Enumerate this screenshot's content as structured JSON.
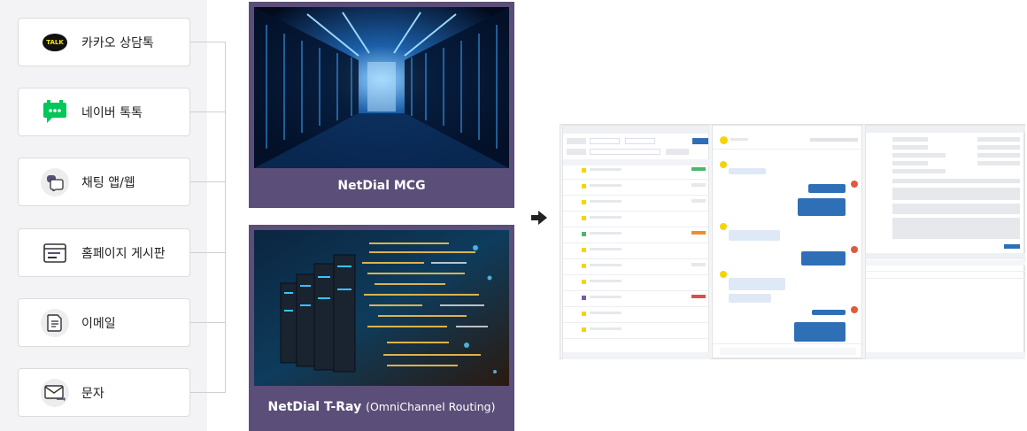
{
  "channels": [
    {
      "label": "카카오 상담톡",
      "icon": "kakaotalk-icon",
      "badge": "TALK"
    },
    {
      "label": "네이버 톡톡",
      "icon": "naver-talktalk-icon"
    },
    {
      "label": "채팅 앱/웹",
      "icon": "chat-bubbles-icon"
    },
    {
      "label": "홈페이지 게시판",
      "icon": "browser-window-icon"
    },
    {
      "label": "이메일",
      "icon": "document-icon"
    },
    {
      "label": "문자",
      "icon": "envelope-icon"
    }
  ],
  "platforms": [
    {
      "title": "NetDial MCG",
      "subtitle": ""
    },
    {
      "title": "NetDial T-Ray",
      "subtitle": "(OmniChannel Routing)"
    }
  ],
  "colors": {
    "platform_bg": "#5b4e78",
    "kakao_yellow": "#f7e600",
    "naver_green": "#03c75a",
    "accent_blue": "#2f6fb5"
  }
}
